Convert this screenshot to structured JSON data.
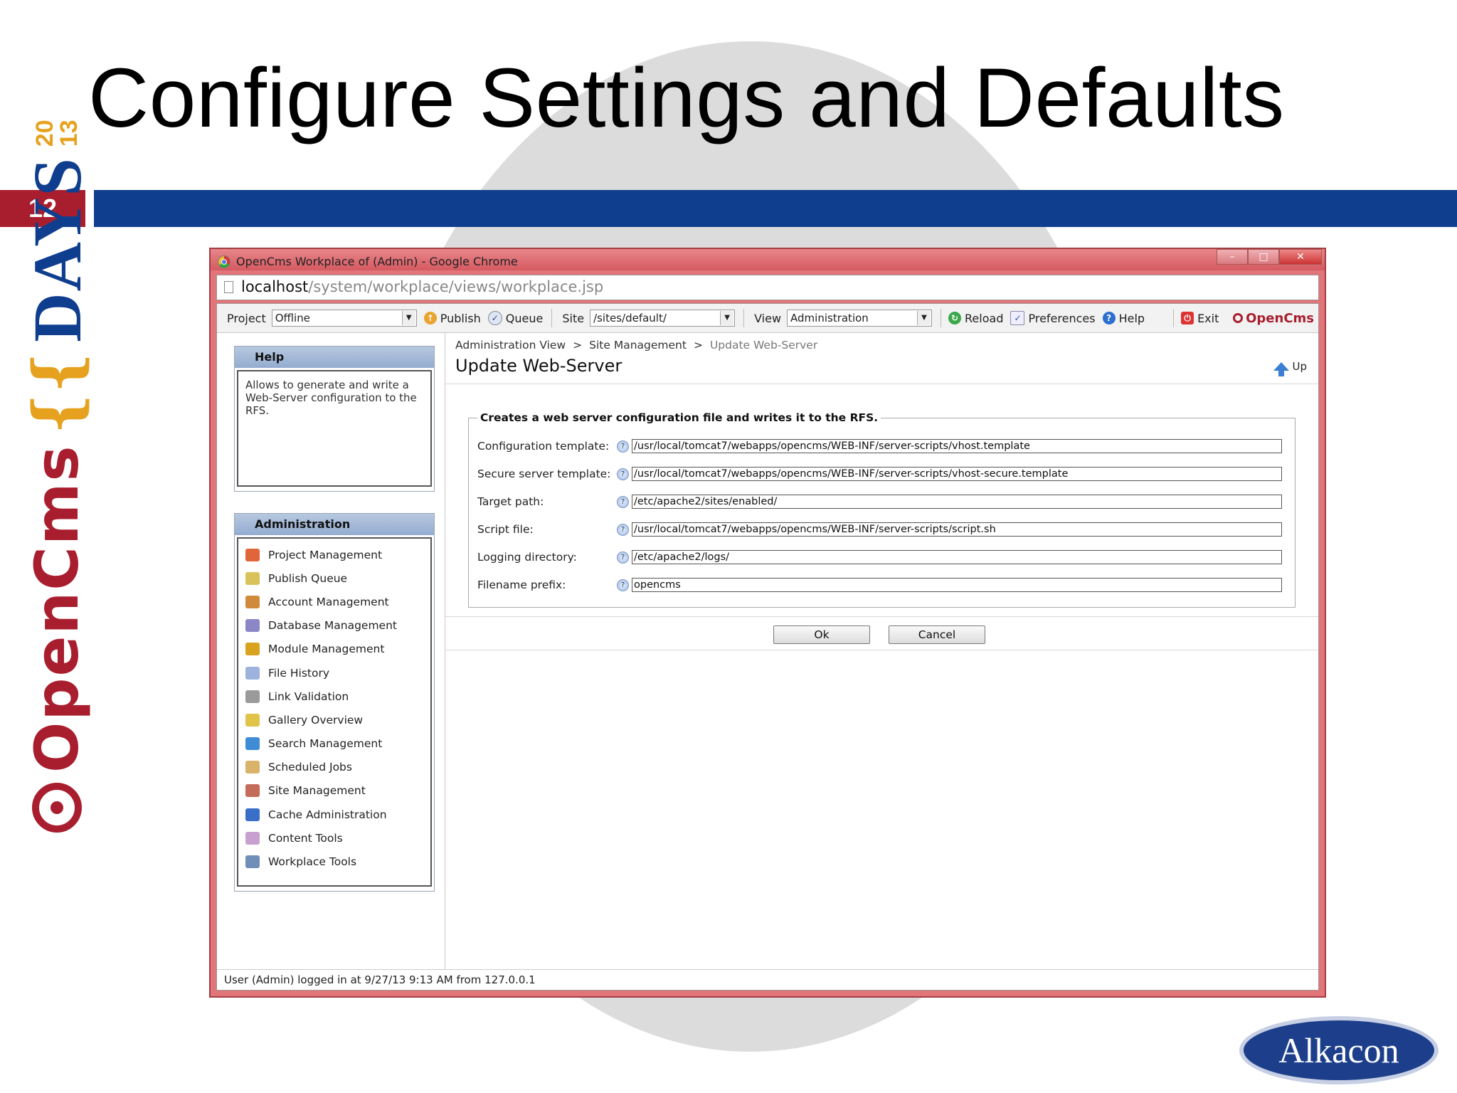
{
  "slide": {
    "title": "Configure Settings and Defaults",
    "number": "12",
    "side_logo": {
      "brand": "OpenCms",
      "brace": "{{",
      "days": "DAYS",
      "year_top": "20",
      "year_bottom": "13"
    },
    "company_logo": "Alkacon",
    "colors": {
      "red": "#a91e2e",
      "blue": "#0f3e8f",
      "gold": "#e6a21f"
    }
  },
  "window": {
    "title": "OpenCms Workplace of (Admin) - Google Chrome",
    "controls": [
      "minimize",
      "maximize",
      "close"
    ],
    "url_host": "localhost",
    "url_path": "/system/workplace/views/workplace.jsp"
  },
  "toolbar": {
    "project_label": "Project",
    "project_value": "Offline",
    "publish": "Publish",
    "queue": "Queue",
    "site_label": "Site",
    "site_value": "/sites/default/",
    "view_label": "View",
    "view_value": "Administration",
    "reload": "Reload",
    "preferences": "Preferences",
    "help": "Help",
    "exit": "Exit",
    "logo": "OpenCms"
  },
  "help_panel": {
    "title": "Help",
    "text": "Allows to generate and write a Web-Server configuration to the RFS."
  },
  "admin_panel": {
    "title": "Administration",
    "items": [
      {
        "label": "Project Management",
        "icon": "project-icon",
        "color": "#e0663a"
      },
      {
        "label": "Publish Queue",
        "icon": "publish-queue-icon",
        "color": "#d9c25a"
      },
      {
        "label": "Account Management",
        "icon": "accounts-icon",
        "color": "#d08a3c"
      },
      {
        "label": "Database Management",
        "icon": "database-icon",
        "color": "#8a86c8"
      },
      {
        "label": "Module Management",
        "icon": "module-icon",
        "color": "#d9a21f"
      },
      {
        "label": "File History",
        "icon": "file-history-icon",
        "color": "#9db3dd"
      },
      {
        "label": "Link Validation",
        "icon": "link-icon",
        "color": "#9a9a9a"
      },
      {
        "label": "Gallery Overview",
        "icon": "gallery-icon",
        "color": "#e0c44a"
      },
      {
        "label": "Search Management",
        "icon": "search-icon",
        "color": "#3f8bd6"
      },
      {
        "label": "Scheduled Jobs",
        "icon": "calendar-icon",
        "color": "#d9b36a"
      },
      {
        "label": "Site Management",
        "icon": "site-icon",
        "color": "#c46b5a"
      },
      {
        "label": "Cache Administration",
        "icon": "cache-icon",
        "color": "#3a6fc8"
      },
      {
        "label": "Content Tools",
        "icon": "content-tools-icon",
        "color": "#c8a0d0"
      },
      {
        "label": "Workplace Tools",
        "icon": "workplace-tools-icon",
        "color": "#6f8fb8"
      }
    ]
  },
  "main": {
    "breadcrumb": [
      "Administration View",
      "Site Management",
      "Update Web-Server"
    ],
    "heading": "Update Web-Server",
    "up": "Up",
    "legend": "Creates a web server configuration file and writes it to the RFS.",
    "fields": [
      {
        "label": "Configuration template:",
        "value": "/usr/local/tomcat7/webapps/opencms/WEB-INF/server-scripts/vhost.template"
      },
      {
        "label": "Secure server template:",
        "value": "/usr/local/tomcat7/webapps/opencms/WEB-INF/server-scripts/vhost-secure.template"
      },
      {
        "label": "Target path:",
        "value": "/etc/apache2/sites/enabled/"
      },
      {
        "label": "Script file:",
        "value": "/usr/local/tomcat7/webapps/opencms/WEB-INF/server-scripts/script.sh"
      },
      {
        "label": "Logging directory:",
        "value": "/etc/apache2/logs/"
      },
      {
        "label": "Filename prefix:",
        "value": "opencms"
      }
    ],
    "ok": "Ok",
    "cancel": "Cancel"
  },
  "status_bar": "User (Admin) logged in at 9/27/13 9:13 AM from 127.0.0.1"
}
